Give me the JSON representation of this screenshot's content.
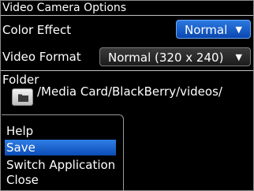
{
  "screen": {
    "title": "Video Camera Options"
  },
  "color_effect": {
    "label": "Color Effect",
    "value": "Normal",
    "arrow": "▼"
  },
  "video_format": {
    "label": "Video Format",
    "value": "Normal (320 x 240)",
    "arrow": "▼"
  },
  "folder": {
    "label": "Folder",
    "path": "/Media Card/BlackBerry/videos/"
  },
  "menu": {
    "items": [
      {
        "label": "Help"
      },
      {
        "label": "Save",
        "selected": true
      },
      {
        "label": "Switch Application"
      },
      {
        "label": "Close"
      }
    ]
  },
  "colors": {
    "accent": "#1b5fd0",
    "background": "#000000",
    "text": "#ffffff"
  }
}
